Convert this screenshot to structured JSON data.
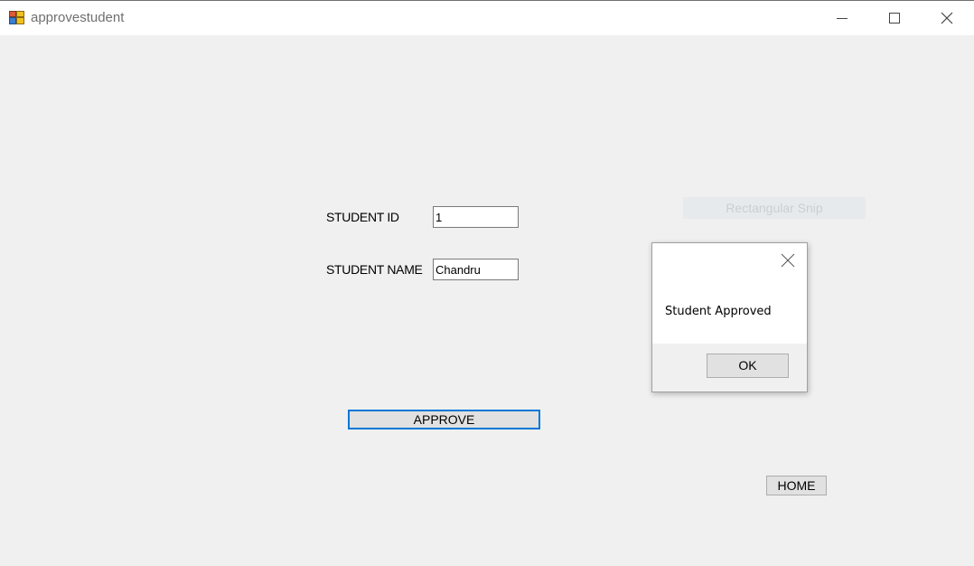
{
  "window": {
    "title": "approvestudent",
    "icon": "windows-forms-app-icon",
    "controls": [
      "minimize-icon",
      "maximize-icon",
      "close-icon"
    ]
  },
  "form": {
    "student_id_label": "STUDENT ID",
    "student_id_value": "1",
    "student_name_label": "STUDENT NAME",
    "student_name_value": "Chandru",
    "approve_label": "APPROVE",
    "home_label": "HOME"
  },
  "overlay": {
    "snip_label": "Rectangular Snip"
  },
  "message_box": {
    "text": "Student Approved",
    "ok_label": "OK"
  },
  "colors": {
    "focus_border": "#0078d7",
    "form_background": "#f0f0f0"
  }
}
